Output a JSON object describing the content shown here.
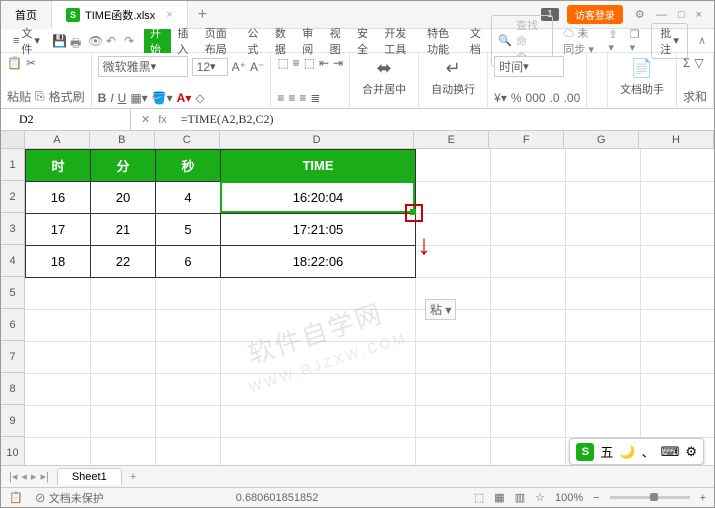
{
  "tabs": {
    "home": "首页",
    "file": "TIME函数.xlsx",
    "plus": "+"
  },
  "title_right": {
    "badge": "1",
    "login": "访客登录"
  },
  "menu": {
    "file": "文件",
    "items": [
      "开始",
      "插入",
      "页面布局",
      "公式",
      "数据",
      "审阅",
      "视图",
      "安全",
      "开发工具",
      "特色功能",
      "文档"
    ],
    "search_placeholder": "查找命令…",
    "sync": "未同步",
    "batch": "批注"
  },
  "ribbon": {
    "paste": "粘贴",
    "brush": "格式刷",
    "font": "微软雅黑",
    "size": "12",
    "merge": "合并居中",
    "wrap": "自动换行",
    "numfmt": "时间",
    "assist": "文档助手",
    "sum": "求和"
  },
  "formula": {
    "cellref": "D2",
    "fx": "fx",
    "text": "=TIME(A2,B2,C2)"
  },
  "cols": [
    "A",
    "B",
    "C",
    "D",
    "E",
    "F",
    "G",
    "H"
  ],
  "rows": [
    "1",
    "2",
    "3",
    "4",
    "5",
    "6",
    "7",
    "8",
    "9",
    "10"
  ],
  "table": {
    "headers": [
      "时",
      "分",
      "秒",
      "TIME"
    ],
    "r1": {
      "a": "16",
      "b": "20",
      "c": "4",
      "d": "16:20:04"
    },
    "r2": {
      "a": "17",
      "b": "21",
      "c": "5",
      "d": "17:21:05"
    },
    "r3": {
      "a": "18",
      "b": "22",
      "c": "6",
      "d": "18:22:06"
    }
  },
  "paste_opts": "粘",
  "sheet": {
    "name": "Sheet1"
  },
  "status": {
    "protect": "文档未保护",
    "value": "0.680601851852",
    "zoom": "100%"
  },
  "ime": "五",
  "watermark": {
    "l1": "软件自学网",
    "l2": "WWW.RJZXW.COM"
  }
}
